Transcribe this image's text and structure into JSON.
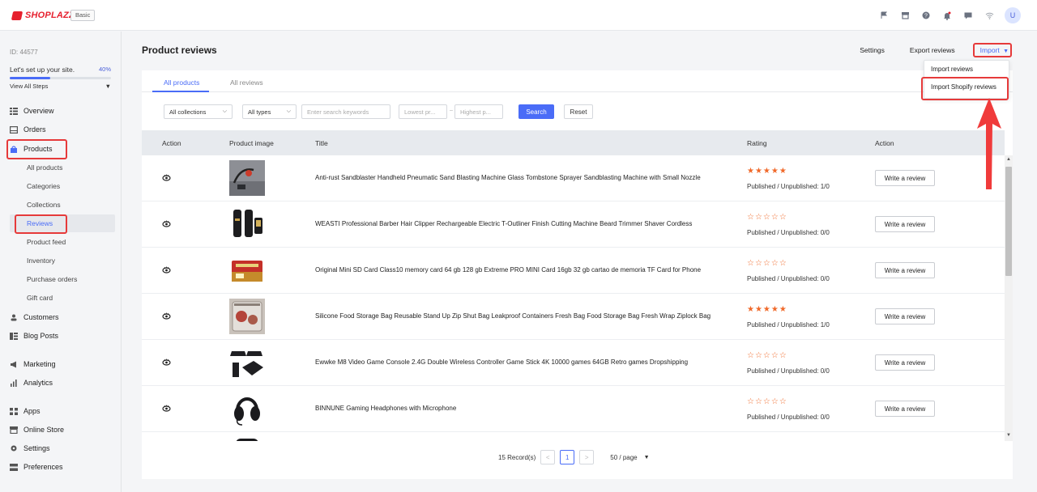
{
  "topbar": {
    "logo_text": "SHOPLAZZA",
    "plan": "Basic",
    "icons": [
      "flag-icon",
      "store-icon",
      "help-icon",
      "bell-icon",
      "message-icon",
      "wifi-icon"
    ],
    "avatar_letter": "U"
  },
  "sidebar": {
    "store_id": "ID: 44577",
    "setup_label": "Let's set up your site.",
    "setup_percent": "40%",
    "setup_progress": 0.4,
    "view_steps": "View All Steps",
    "items": {
      "overview": "Overview",
      "orders": "Orders",
      "products": "Products",
      "all_products": "All products",
      "categories": "Categories",
      "collections": "Collections",
      "reviews": "Reviews",
      "product_feed": "Product feed",
      "inventory": "Inventory",
      "purchase_orders": "Purchase orders",
      "gift_card": "Gift card",
      "customers": "Customers",
      "blog_posts": "Blog Posts",
      "marketing": "Marketing",
      "analytics": "Analytics",
      "apps": "Apps",
      "online_store": "Online Store",
      "settings": "Settings",
      "preferences": "Preferences"
    }
  },
  "header": {
    "title": "Product reviews",
    "settings": "Settings",
    "export": "Export reviews",
    "import": "Import",
    "dropdown": [
      "Import reviews",
      "Import Shopify reviews"
    ]
  },
  "tabs": {
    "all_products": "All products",
    "all_reviews": "All reviews"
  },
  "filters": {
    "collections": "All collections",
    "types": "All types",
    "search_placeholder": "Enter search keywords",
    "lowest_placeholder": "Lowest pr...",
    "highest_placeholder": "Highest p...",
    "search_btn": "Search",
    "reset_btn": "Reset"
  },
  "table": {
    "headers": {
      "action": "Action",
      "image": "Product image",
      "title": "Title",
      "rating": "Rating",
      "action2": "Action"
    },
    "rows": [
      {
        "title": "Anti-rust Sandblaster Handheld Pneumatic Sand Blasting Machine Glass Tombstone Sprayer Sandblasting Machine with Small Nozzle",
        "stars": "★★★★★",
        "rating": 4.5,
        "published": "Published / Unpublished: 1/0",
        "button": "Write a review"
      },
      {
        "title": "WEASTI Professional Barber Hair Clipper Rechargeable Electric T-Outliner Finish Cutting Machine Beard Trimmer Shaver Cordless",
        "stars": "☆☆☆☆☆",
        "rating": 0,
        "published": "Published / Unpublished: 0/0",
        "button": "Write a review"
      },
      {
        "title": "Original Mini SD Card Class10 memory card 64 gb 128 gb Extreme PRO MINI Card 16gb 32 gb cartao de memoria TF Card for Phone",
        "stars": "☆☆☆☆☆",
        "rating": 0,
        "published": "Published / Unpublished: 0/0",
        "button": "Write a review"
      },
      {
        "title": "Silicone Food Storage Bag Reusable Stand Up Zip Shut Bag Leakproof Containers Fresh Bag Food Storage Bag Fresh Wrap Ziplock Bag",
        "stars": "★★★★★",
        "rating": 5,
        "published": "Published / Unpublished: 1/0",
        "button": "Write a review"
      },
      {
        "title": "Ewwke M8 Video Game Console 2.4G Double Wireless Controller Game Stick 4K 10000 games 64GB Retro games Dropshipping",
        "stars": "☆☆☆☆☆",
        "rating": 0,
        "published": "Published / Unpublished: 0/0",
        "button": "Write a review"
      },
      {
        "title": "BINNUNE Gaming Headphones with Microphone",
        "stars": "☆☆☆☆☆",
        "rating": 0,
        "published": "Published / Unpublished: 0/0",
        "button": "Write a review"
      }
    ]
  },
  "pager": {
    "records": "15 Record(s)",
    "current_page": "1",
    "per_page": "50 / page"
  },
  "colors": {
    "accent": "#4a6cf7",
    "brand": "#e6202e",
    "highlight": "#e63a3a",
    "star": "#f0692a"
  }
}
